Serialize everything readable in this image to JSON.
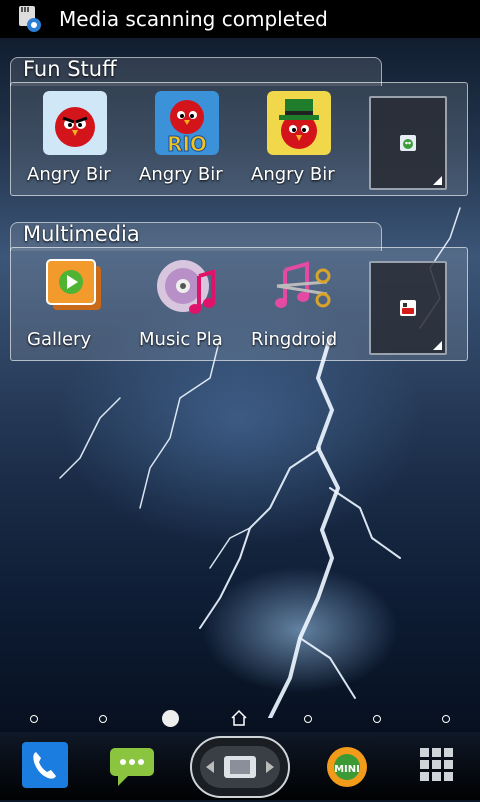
{
  "status_bar": {
    "notification_text": "Media scanning completed",
    "icon": "media-scan-icon"
  },
  "folders": [
    {
      "title": "Fun Stuff",
      "apps": [
        {
          "label": "Angry Bir",
          "icon": "angry-birds-icon"
        },
        {
          "label": "Angry Bir",
          "icon": "angry-birds-rio-icon"
        },
        {
          "label": "Angry Bir",
          "icon": "angry-birds-seasons-icon"
        }
      ],
      "widget_icon": "small-app-icon"
    },
    {
      "title": "Multimedia",
      "apps": [
        {
          "label": "Gallery",
          "icon": "gallery-icon"
        },
        {
          "label": "Music Pla",
          "icon": "music-player-icon"
        },
        {
          "label": "Ringdroid",
          "icon": "ringdroid-icon"
        }
      ],
      "widget_icon": "youtube-icon"
    }
  ],
  "page_indicator": {
    "count": 7,
    "active_index": 2,
    "home_index": 3
  },
  "dock": [
    {
      "name": "phone-icon"
    },
    {
      "name": "messaging-icon"
    },
    {
      "name": "launcher-toggle-icon"
    },
    {
      "name": "browser-mini-icon"
    },
    {
      "name": "app-drawer-icon"
    }
  ]
}
